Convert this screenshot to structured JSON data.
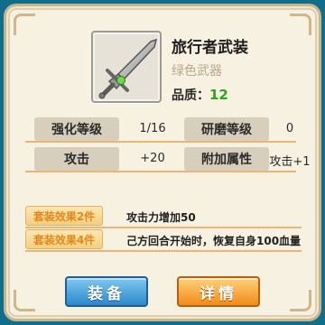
{
  "item": {
    "name": "旅行者武装",
    "category": "绿色武器",
    "quality_label": "品质：",
    "quality_value": "12",
    "icon": "sword-icon"
  },
  "stats": [
    {
      "label": "强化等级",
      "value": "1/16",
      "label2": "研磨等级",
      "value2": "0"
    },
    {
      "label": "攻击",
      "value": "+20",
      "label2": "附加属性",
      "value2": "攻击+1"
    }
  ],
  "sets": [
    {
      "label": "套装效果2件",
      "text": "攻击力增加50"
    },
    {
      "label": "套装效果4件",
      "text": "己方回合开始时，恢复自身100血量"
    }
  ],
  "buttons": {
    "equip": "装备",
    "detail": "详情"
  },
  "colors": {
    "quality": "#2aa41c",
    "set_label": "#e2891a",
    "equip_button": "#2d88cc",
    "detail_button": "#f08b1a"
  }
}
